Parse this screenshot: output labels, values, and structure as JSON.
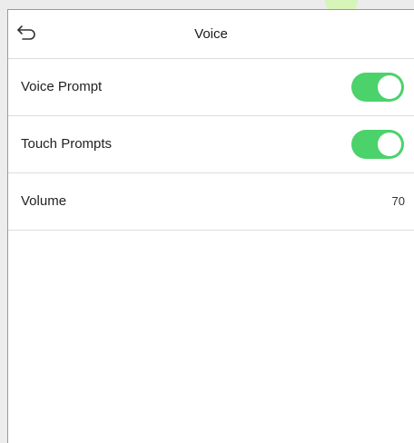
{
  "header": {
    "title": "Voice",
    "back_icon": "back-arrow-icon"
  },
  "settings": [
    {
      "label": "Voice Prompt",
      "type": "toggle",
      "on": true
    },
    {
      "label": "Touch Prompts",
      "type": "toggle",
      "on": true
    },
    {
      "label": "Volume",
      "type": "value",
      "value": "70"
    }
  ],
  "colors": {
    "toggle_on": "#4cd26b",
    "background": "#ffffff",
    "divider": "#dcdcdc"
  }
}
